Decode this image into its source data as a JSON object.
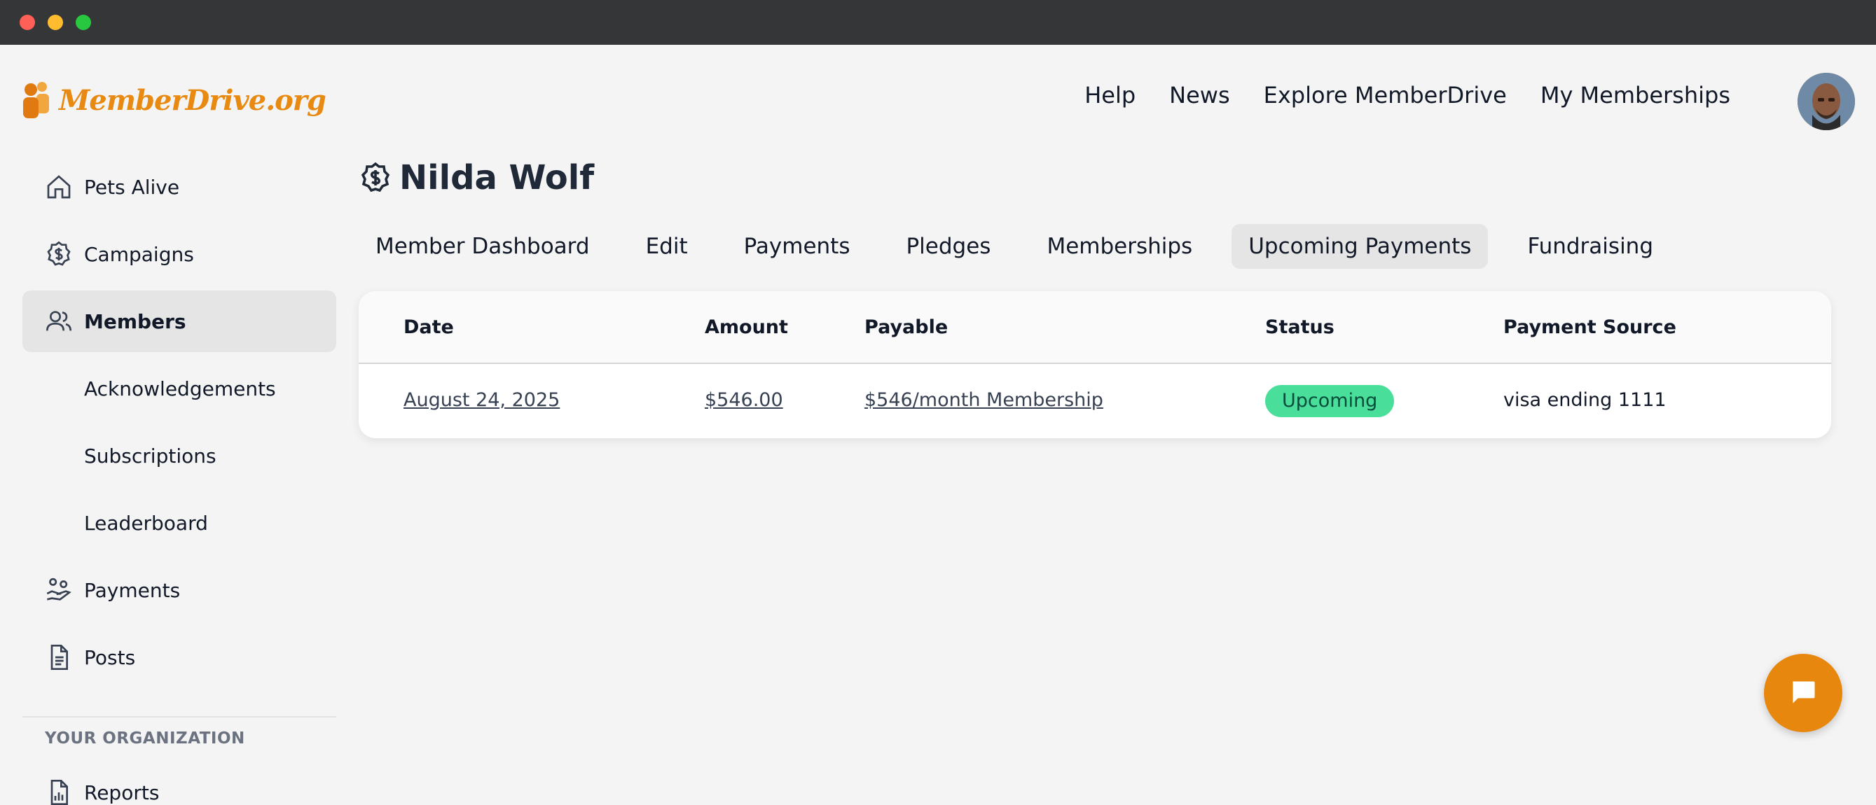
{
  "brand": {
    "name": "MemberDrive.org",
    "color": "#e88a12"
  },
  "topnav": [
    "Help",
    "News",
    "Explore MemberDrive",
    "My Memberships"
  ],
  "sidebar": {
    "items": [
      {
        "label": "Pets Alive",
        "icon": "home-icon"
      },
      {
        "label": "Campaigns",
        "icon": "dollar-badge-icon"
      },
      {
        "label": "Members",
        "icon": "users-icon",
        "active": true
      },
      {
        "label": "Acknowledgements"
      },
      {
        "label": "Subscriptions"
      },
      {
        "label": "Leaderboard"
      },
      {
        "label": "Payments",
        "icon": "hand-coins-icon"
      },
      {
        "label": "Posts",
        "icon": "document-icon"
      }
    ],
    "section_title": "YOUR ORGANIZATION",
    "org_items": [
      {
        "label": "Reports",
        "icon": "report-icon"
      }
    ]
  },
  "page": {
    "title": "Nilda Wolf"
  },
  "tabs": [
    {
      "label": "Member Dashboard"
    },
    {
      "label": "Edit"
    },
    {
      "label": "Payments"
    },
    {
      "label": "Pledges"
    },
    {
      "label": "Memberships"
    },
    {
      "label": "Upcoming Payments",
      "active": true
    },
    {
      "label": "Fundraising"
    }
  ],
  "table": {
    "headers": [
      "Date",
      "Amount",
      "Payable",
      "Status",
      "Payment Source"
    ],
    "rows": [
      {
        "date": "August 24, 2025",
        "amount": "$546.00",
        "payable": "$546/month Membership",
        "status": "Upcoming",
        "source": "visa ending 1111"
      }
    ]
  },
  "colors": {
    "status_upcoming": "#4ade9b",
    "chat_button": "#e8870e"
  }
}
